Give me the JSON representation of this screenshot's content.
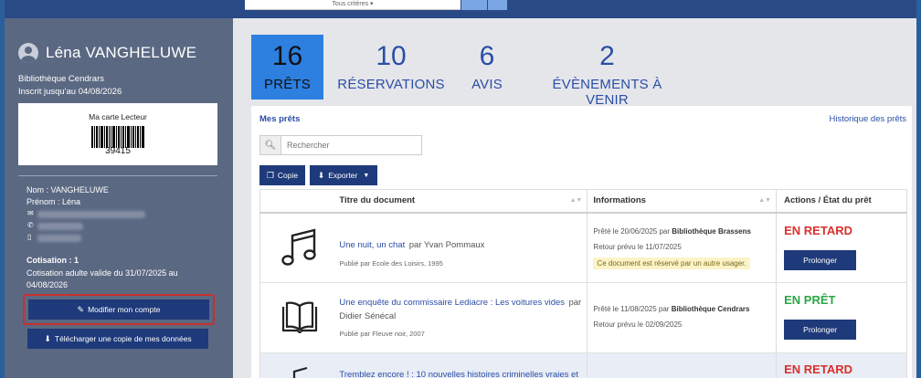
{
  "top_bar": {
    "criteria_select": "Tous critères"
  },
  "sidebar": {
    "user_name": "Léna VANGHELUWE",
    "library": "Bibliothèque Cendrars",
    "subscription_until": "Inscrit jusqu'au 04/08/2026",
    "card": {
      "title": "Ma carte Lecteur",
      "number": "39415"
    },
    "nom": "Nom : VANGHELUWE",
    "prenom": "Prénom : Léna",
    "cotisation_title": "Cotisation : 1",
    "cotisation_text": "Cotisation adulte valide du 31/07/2025 au 04/08/2026",
    "modify_button": "Modifier mon compte",
    "download_button": "Télécharger une copie de mes données"
  },
  "tabs": [
    {
      "num": "16",
      "label": "PRÊTS",
      "active": true
    },
    {
      "num": "10",
      "label": "RÉSERVATIONS"
    },
    {
      "num": "6",
      "label": "AVIS"
    },
    {
      "num": "2",
      "label": "ÉVÈNEMENTS À VENIR"
    }
  ],
  "panel": {
    "title": "Mes prêts",
    "history_link": "Historique des prêts",
    "search_placeholder": "Rechercher",
    "copy_button": "Copie",
    "export_button": "Exporter",
    "columns": [
      "Titre du document",
      "Informations",
      "Actions / État du prêt"
    ],
    "rows": [
      {
        "icon": "music-icon",
        "title": "Une nuit, un chat",
        "by": "par Yvan Pommaux",
        "pub": "Publié par Ecole des Loisirs, 1995",
        "lent": "Prêté le 20/06/2025 par",
        "lent_lib": "Bibliothèque Brassens",
        "return": "Retour prévu le 11/07/2025",
        "reserved": "Ce document est réservé par un autre usager.",
        "status": "EN RETARD",
        "action": "Prolonger"
      },
      {
        "icon": "book-icon",
        "title": "Une enquête du commissaire Lediacre : Les voitures vides",
        "by": "par Didier Sénécal",
        "pub": "Publié par Fleuve noir, 2007",
        "lent": "Prêté le 11/08/2025 par",
        "lent_lib": "Bibliothèque Cendrars",
        "return": "Retour prévu le 02/09/2025",
        "status": "EN PRÊT",
        "action": "Prolonger"
      },
      {
        "icon": "music-icon",
        "title": "Tremblez encore ! : 10 nouvelles histoires criminelles vraies et",
        "status": "EN RETARD"
      }
    ]
  },
  "colors": {
    "accent": "#2d7fe0",
    "primary_button": "#1e3a7a",
    "late": "#d9302c",
    "ok": "#2aa845",
    "sidebar": "#5b6882"
  }
}
